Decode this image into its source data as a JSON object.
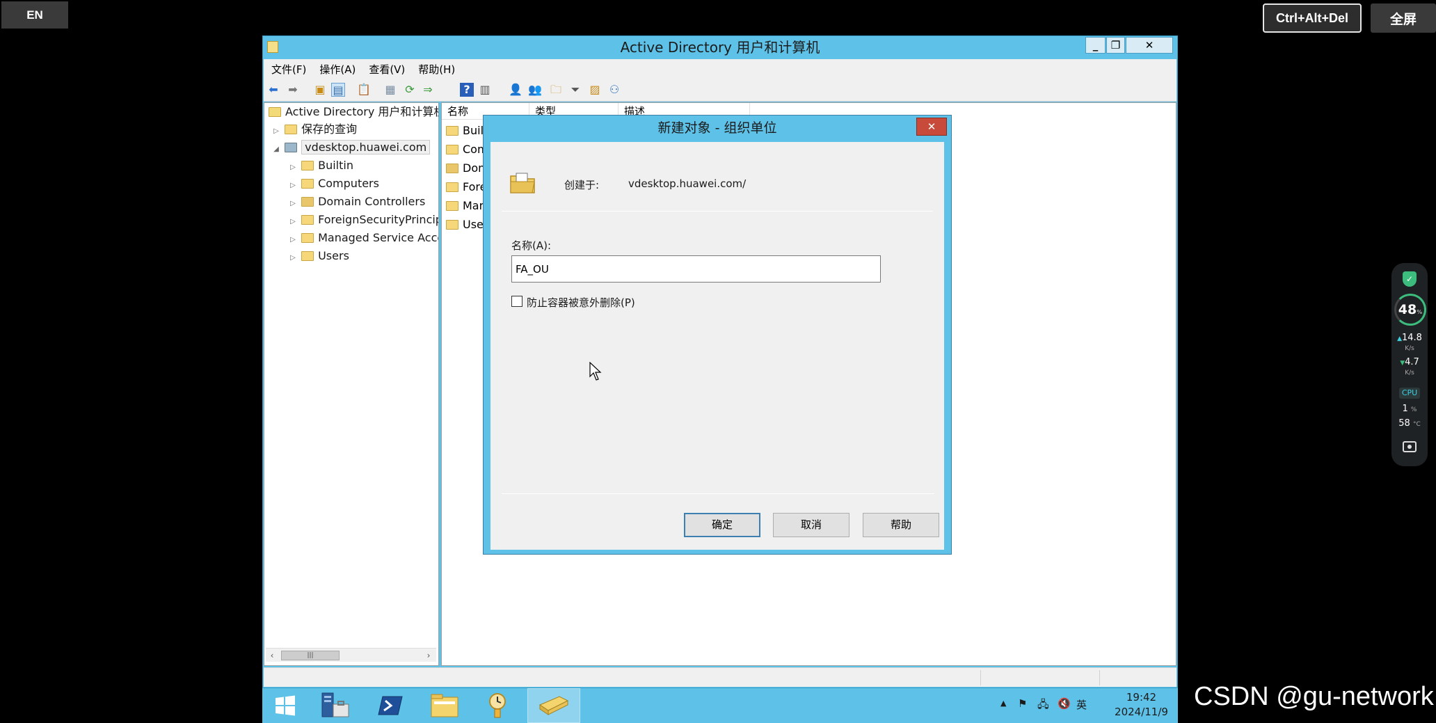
{
  "remote": {
    "lang": "EN",
    "cad": "Ctrl+Alt+Del",
    "fullscreen": "全屏"
  },
  "monitor": {
    "percent": "48",
    "percent_unit": "%",
    "up_speed": "14.8",
    "down_speed": "4.7",
    "speed_unit": "K/s",
    "cpu_label": "CPU",
    "cpu_value": "1",
    "cpu_unit": "%",
    "temp_value": "58",
    "temp_unit": "°C"
  },
  "watermark": "CSDN @gu-network",
  "window": {
    "title": "Active Directory 用户和计算机",
    "menu": [
      "文件(F)",
      "操作(A)",
      "查看(V)",
      "帮助(H)"
    ],
    "tree": {
      "root": "Active Directory 用户和计算机",
      "saved_queries": "保存的查询",
      "domain": "vdesktop.huawei.com",
      "children": [
        "Builtin",
        "Computers",
        "Domain Controllers",
        "ForeignSecurityPrincip...",
        "Managed Service Acco...",
        "Users"
      ]
    },
    "list": {
      "columns": [
        "名称",
        "类型",
        "描述"
      ],
      "rows": [
        "Built",
        "Com",
        "Dom",
        "Fore",
        "Man",
        "User"
      ]
    }
  },
  "dialog": {
    "title": "新建对象 - 组织单位",
    "created_in_label": "创建于:",
    "created_in_value": "vdesktop.huawei.com/",
    "name_label": "名称(A):",
    "name_value": "FA_OU",
    "protect_label": "防止容器被意外删除(P)",
    "protect_checked": false,
    "ok": "确定",
    "cancel": "取消",
    "help": "帮助"
  },
  "taskbar": {
    "ime": "英",
    "time": "19:42",
    "date": "2024/11/9"
  }
}
